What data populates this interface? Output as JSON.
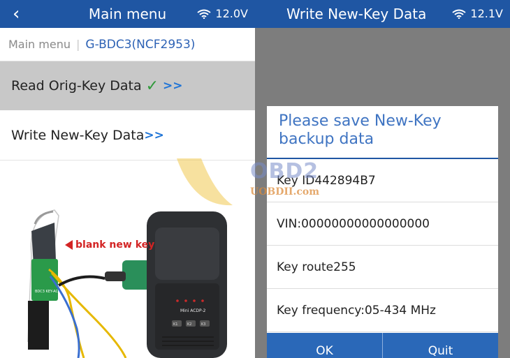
{
  "left": {
    "header": {
      "back_icon": "chevron-left-icon",
      "title": "Main menu",
      "signal_icon": "wifi-icon",
      "voltage": "12.0V"
    },
    "breadcrumb": {
      "home": "Main menu",
      "separator": "|",
      "model": "G-BDC3(NCF2953)"
    },
    "menu": [
      {
        "label": "Read Orig-Key Data",
        "check": "✓",
        "arrows": ">>"
      },
      {
        "label": "Write New-Key Data",
        "arrows": ">>"
      }
    ],
    "photo": {
      "callout": "blank new key",
      "device_label": "Mini ACDP-2",
      "device_buttons": [
        "K1",
        "K2",
        "K3"
      ],
      "board_label": "BDC3 KEY-ACDP"
    }
  },
  "right": {
    "header": {
      "title": "Write New-Key Data",
      "signal_icon": "wifi-icon",
      "voltage": "12.1V"
    },
    "dialog": {
      "title_line1": "Please save New-Key",
      "title_line2": "backup data",
      "rows": [
        "Key ID442894B7",
        "VIN:00000000000000000",
        "Key route255",
        "Key frequency:05-434 MHz"
      ],
      "ok_label": "OK",
      "quit_label": "Quit"
    }
  },
  "watermark": {
    "text": "OBD2",
    "subtext": "UOBDII.com"
  },
  "colors": {
    "header": "#1f56a3",
    "accent": "#1f74d6",
    "check": "#2f9a3a",
    "callout": "#d32424",
    "overlay": "#7d7d7d"
  }
}
